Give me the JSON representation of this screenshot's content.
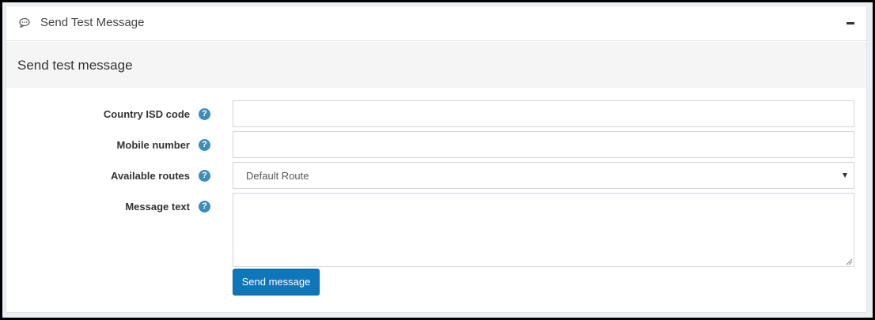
{
  "panel": {
    "title": "Send Test Message",
    "icon": "chat-bubble-icon",
    "collapse_icon": "minus-icon"
  },
  "section": {
    "title": "Send test message"
  },
  "form": {
    "fields": [
      {
        "label": "Country ISD code",
        "value": "",
        "type": "text"
      },
      {
        "label": "Mobile number",
        "value": "",
        "type": "text"
      },
      {
        "label": "Available routes",
        "value": "Default Route",
        "type": "select"
      },
      {
        "label": "Message text",
        "value": "",
        "type": "textarea"
      }
    ],
    "help_icon": "question-circle-icon",
    "submit_label": "Send message"
  },
  "colors": {
    "accent": "#3c8dbc",
    "button": "#0f76b9",
    "section_bg": "#f5f5f5"
  }
}
